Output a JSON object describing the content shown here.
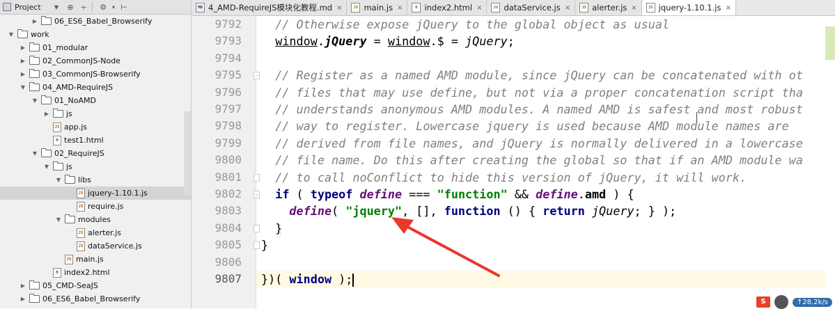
{
  "project_panel": {
    "title": "Project",
    "toolbar_icons": [
      "target-icon",
      "collapse-all-icon",
      "settings-icon",
      "hide-panel-icon"
    ],
    "tree": [
      {
        "depth": 2,
        "arrow": "collapsed",
        "kind": "folder",
        "label": "06_ES6_Babel_Browserify"
      },
      {
        "depth": 0,
        "arrow": "expanded",
        "kind": "folder",
        "label": "work"
      },
      {
        "depth": 1,
        "arrow": "collapsed",
        "kind": "folder",
        "label": "01_modular"
      },
      {
        "depth": 1,
        "arrow": "collapsed",
        "kind": "folder",
        "label": "02_CommonJS-Node"
      },
      {
        "depth": 1,
        "arrow": "collapsed",
        "kind": "folder",
        "label": "03_CommonJS-Browserify"
      },
      {
        "depth": 1,
        "arrow": "expanded",
        "kind": "folder",
        "label": "04_AMD-RequireJS"
      },
      {
        "depth": 2,
        "arrow": "expanded",
        "kind": "folder",
        "label": "01_NoAMD"
      },
      {
        "depth": 3,
        "arrow": "collapsed",
        "kind": "folder",
        "label": "js"
      },
      {
        "depth": 3,
        "arrow": "none",
        "kind": "js",
        "label": "app.js"
      },
      {
        "depth": 3,
        "arrow": "none",
        "kind": "html",
        "label": "test1.html"
      },
      {
        "depth": 2,
        "arrow": "expanded",
        "kind": "folder",
        "label": "02_RequireJS"
      },
      {
        "depth": 3,
        "arrow": "expanded",
        "kind": "folder",
        "label": "js"
      },
      {
        "depth": 4,
        "arrow": "expanded",
        "kind": "folder",
        "label": "libs"
      },
      {
        "depth": 5,
        "arrow": "none",
        "kind": "js",
        "label": "jquery-1.10.1.js",
        "selected": true
      },
      {
        "depth": 5,
        "arrow": "none",
        "kind": "js",
        "label": "require.js"
      },
      {
        "depth": 4,
        "arrow": "expanded",
        "kind": "folder",
        "label": "modules"
      },
      {
        "depth": 5,
        "arrow": "none",
        "kind": "js",
        "label": "alerter.js"
      },
      {
        "depth": 5,
        "arrow": "none",
        "kind": "js",
        "label": "dataService.js"
      },
      {
        "depth": 4,
        "arrow": "none",
        "kind": "js",
        "label": "main.js"
      },
      {
        "depth": 3,
        "arrow": "none",
        "kind": "html",
        "label": "index2.html"
      },
      {
        "depth": 1,
        "arrow": "collapsed",
        "kind": "folder",
        "label": "05_CMD-SeaJS"
      },
      {
        "depth": 1,
        "arrow": "collapsed",
        "kind": "folder",
        "label": "06_ES6_Babel_Browserify"
      }
    ]
  },
  "tabs": [
    {
      "label": "4_AMD-RequireJS模块化教程.md",
      "icon": "md",
      "active": false
    },
    {
      "label": "main.js",
      "icon": "js",
      "active": false
    },
    {
      "label": "index2.html",
      "icon": "html",
      "active": false
    },
    {
      "label": "dataService.js",
      "icon": "js",
      "active": false
    },
    {
      "label": "alerter.js",
      "icon": "js",
      "active": false
    },
    {
      "label": "jquery-1.10.1.js",
      "icon": "js",
      "active": true
    }
  ],
  "editor": {
    "current_line": "9807",
    "lines": [
      {
        "num": "9792",
        "tokens": [
          [
            "c",
            "  // Otherwise expose jQuery to the global object as usual"
          ]
        ]
      },
      {
        "num": "9793",
        "tokens": [
          [
            "",
            "  "
          ],
          [
            "ul",
            "window"
          ],
          [
            "",
            "."
          ],
          [
            "it2bold",
            "jQuery"
          ],
          [
            "",
            " = "
          ],
          [
            "ul",
            "window"
          ],
          [
            "",
            ".$ = "
          ],
          [
            "it2",
            "jQuery"
          ],
          [
            "",
            ";"
          ]
        ]
      },
      {
        "num": "9794",
        "tokens": []
      },
      {
        "num": "9795",
        "fold": "open",
        "tokens": [
          [
            "c",
            "  // Register as a named AMD module, since jQuery can be concatenated with ot"
          ]
        ]
      },
      {
        "num": "9796",
        "tokens": [
          [
            "c",
            "  // files that may use define, but not via a proper concatenation script tha"
          ]
        ]
      },
      {
        "num": "9797",
        "tokens": [
          [
            "c",
            "  // understands anonymous AMD modules. A named AMD is safest and most robust"
          ]
        ]
      },
      {
        "num": "9798",
        "tokens": [
          [
            "c",
            "  // way to register. Lowercase jquery is used because AMD module names are"
          ]
        ]
      },
      {
        "num": "9799",
        "tokens": [
          [
            "c",
            "  // derived from file names, and jQuery is normally delivered in a lowercase"
          ]
        ]
      },
      {
        "num": "9800",
        "tokens": [
          [
            "c",
            "  // file name. Do this after creating the global so that if an AMD module wa"
          ]
        ]
      },
      {
        "num": "9801",
        "fold": "close",
        "tokens": [
          [
            "c",
            "  // to call noConflict to hide this version of jQuery, it will work."
          ]
        ]
      },
      {
        "num": "9802",
        "fold": "open",
        "tokens": [
          [
            "",
            "  "
          ],
          [
            "kw",
            "if"
          ],
          [
            "",
            " ( "
          ],
          [
            "kw",
            "typeof"
          ],
          [
            "",
            " "
          ],
          [
            "it",
            "define"
          ],
          [
            "",
            " === "
          ],
          [
            "st",
            "\"function\""
          ],
          [
            "",
            " && "
          ],
          [
            "it",
            "define"
          ],
          [
            "",
            "."
          ],
          [
            "bold",
            "amd"
          ],
          [
            "",
            " ) {"
          ]
        ]
      },
      {
        "num": "9803",
        "tokens": [
          [
            "",
            "    "
          ],
          [
            "it",
            "define"
          ],
          [
            "",
            "( "
          ],
          [
            "st",
            "\"jquery\""
          ],
          [
            "",
            ", [], "
          ],
          [
            "kw",
            "function"
          ],
          [
            "",
            " () { "
          ],
          [
            "kw",
            "return"
          ],
          [
            "",
            " "
          ],
          [
            "it2",
            "jQuery"
          ],
          [
            "",
            "; } );"
          ]
        ]
      },
      {
        "num": "9804",
        "fold": "close",
        "tokens": [
          [
            "",
            "  }"
          ]
        ]
      },
      {
        "num": "9805",
        "fold": "close",
        "tokens": [
          [
            "",
            "}"
          ]
        ]
      },
      {
        "num": "9806",
        "tokens": []
      },
      {
        "num": "9807",
        "tokens": [
          [
            "",
            "})( "
          ],
          [
            "kw",
            "window"
          ],
          [
            "",
            " );"
          ]
        ],
        "caret": true
      }
    ]
  },
  "tray": {
    "ime_label": "S",
    "speed": "↑28.2k/s"
  },
  "colors": {
    "annotation_arrow": "#e8382c",
    "caret_line_bg": "#fffae3",
    "selected_row": "#d4d4d4"
  }
}
